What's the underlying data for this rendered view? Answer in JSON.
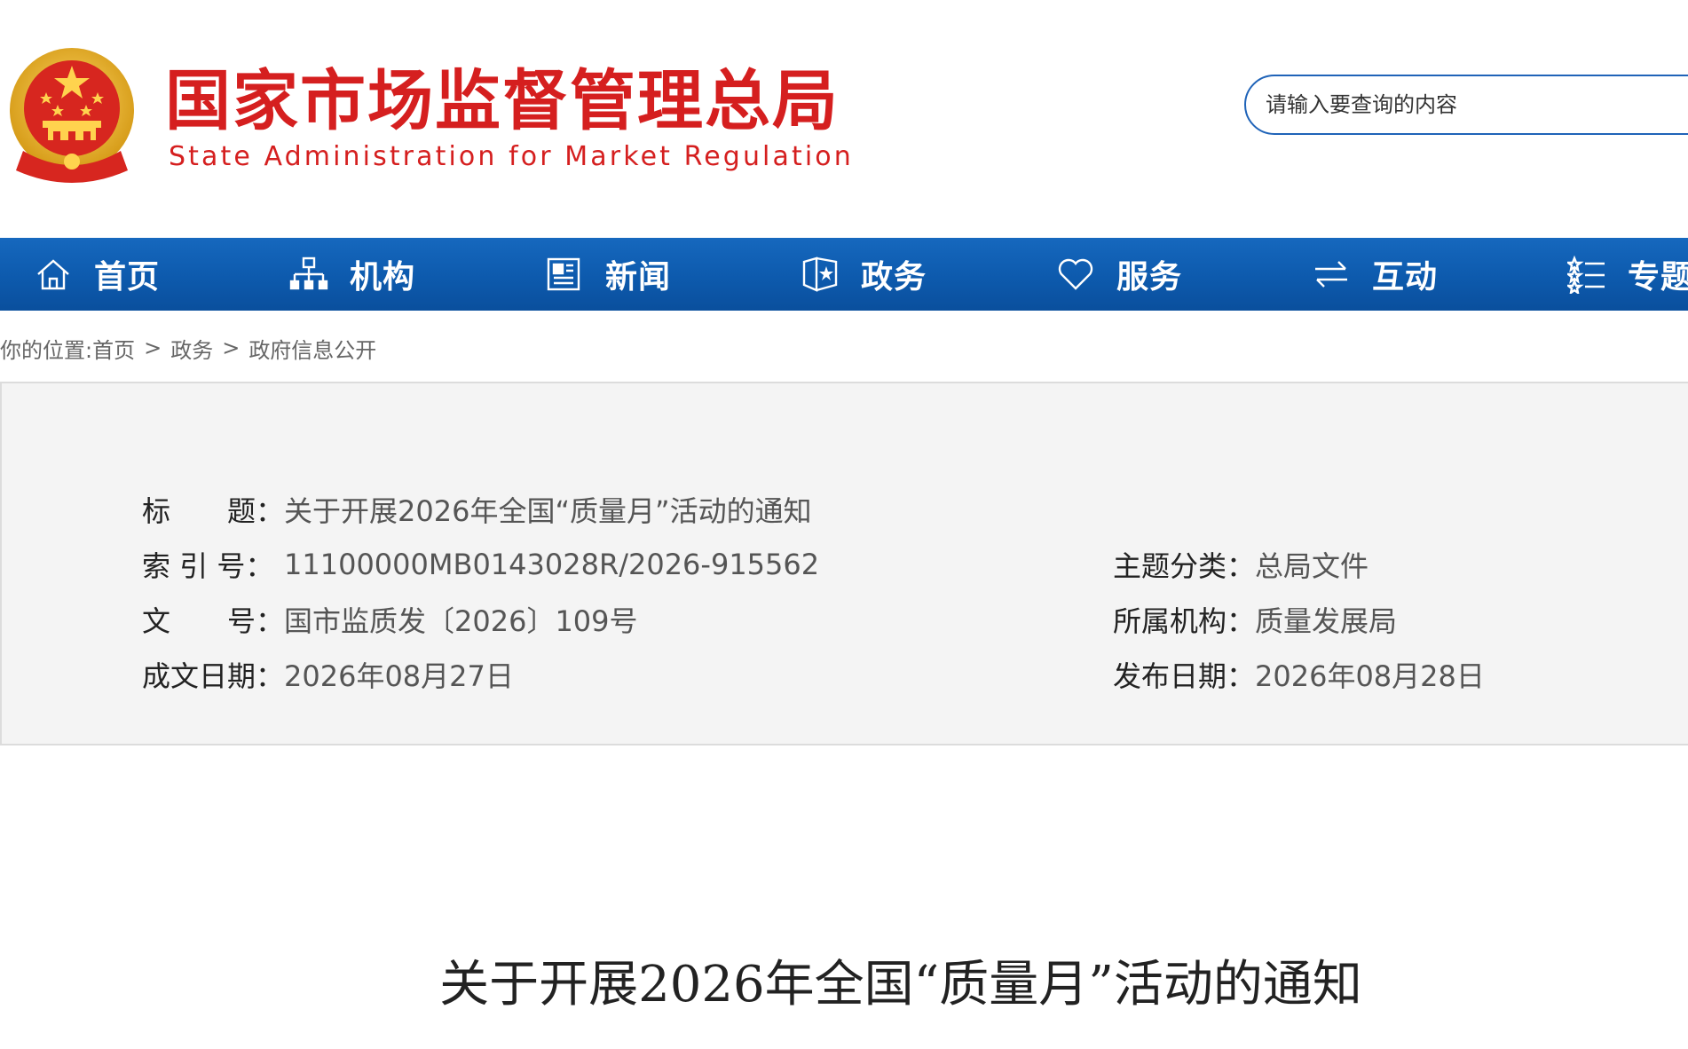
{
  "header": {
    "site_name_cn": "国家市场监督管理总局",
    "site_name_en": "State Administration for Market Regulation",
    "search_placeholder": "请输入要查询的内容"
  },
  "colors": {
    "brand_red": "#d51f1f",
    "nav_blue": "#0d5aad",
    "search_border": "#1f63b8",
    "panel_bg": "#f4f4f4"
  },
  "nav": {
    "items": [
      {
        "label": "首页",
        "icon": "home-icon"
      },
      {
        "label": "机构",
        "icon": "org-chart-icon"
      },
      {
        "label": "新闻",
        "icon": "newspaper-icon"
      },
      {
        "label": "政务",
        "icon": "shield-star-icon"
      },
      {
        "label": "服务",
        "icon": "heart-icon"
      },
      {
        "label": "互动",
        "icon": "swap-arrows-icon"
      },
      {
        "label": "专题",
        "icon": "topic-list-icon"
      }
    ]
  },
  "breadcrumb": {
    "prefix": "你的位置:",
    "items": [
      "首页",
      "政务",
      "政府信息公开"
    ],
    "separator": ">"
  },
  "info": {
    "title_key": "标　　题：",
    "title_val": "关于开展2026年全国“质量月”活动的通知",
    "index_key": "索 引 号：",
    "index_val": "11100000MB0143028R/2026-915562",
    "docno_key": "文　　号：",
    "docno_val": "国市监质发〔2026〕109号",
    "written_key": "成文日期：",
    "written_val": "2026年08月27日",
    "category_key": "主题分类：",
    "category_val": "总局文件",
    "dept_key": "所属机构：",
    "dept_val": "质量发展局",
    "published_key": "发布日期：",
    "published_val": "2026年08月28日"
  },
  "article": {
    "title": "关于开展2026年全国“质量月”活动的通知"
  }
}
